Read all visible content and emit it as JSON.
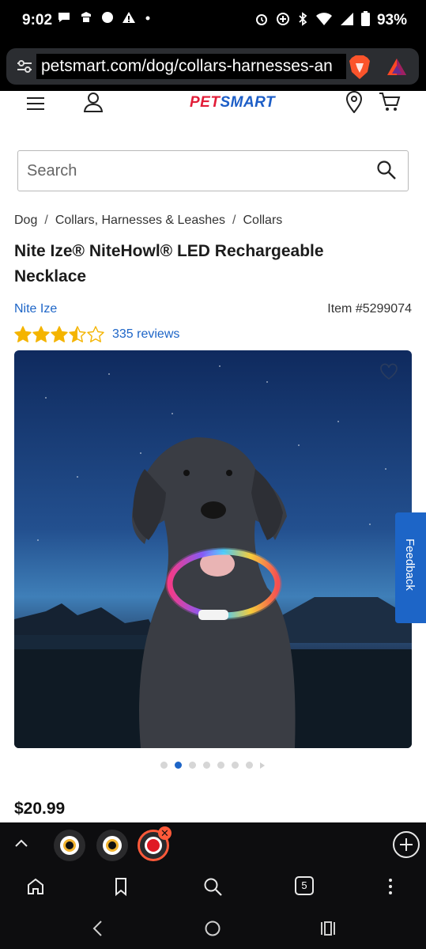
{
  "status_bar": {
    "time": "9:02",
    "battery": "93%"
  },
  "browser": {
    "url": "petsmart.com/dog/collars-harnesses-an",
    "tab_count": "5"
  },
  "site": {
    "logo_pet": "PET",
    "logo_smart": "SMART"
  },
  "search": {
    "placeholder": "Search"
  },
  "breadcrumb": {
    "items": [
      "Dog",
      "Collars, Harnesses & Leashes",
      "Collars"
    ],
    "separator": "/"
  },
  "product": {
    "title": "Nite Ize® NiteHowl® LED Rechargeable Necklace",
    "brand": "Nite Ize",
    "item_number": "Item #5299074",
    "rating": 3.5,
    "rating_max": 5,
    "reviews": "335 reviews",
    "price": "$20.99",
    "image_count": 7,
    "active_image": 2
  },
  "feedback_tab": {
    "label": "Feedback"
  },
  "colors": {
    "accent_blue": "#1d65c7",
    "star_gold": "#f4b400",
    "brand_red": "#e21d38"
  }
}
